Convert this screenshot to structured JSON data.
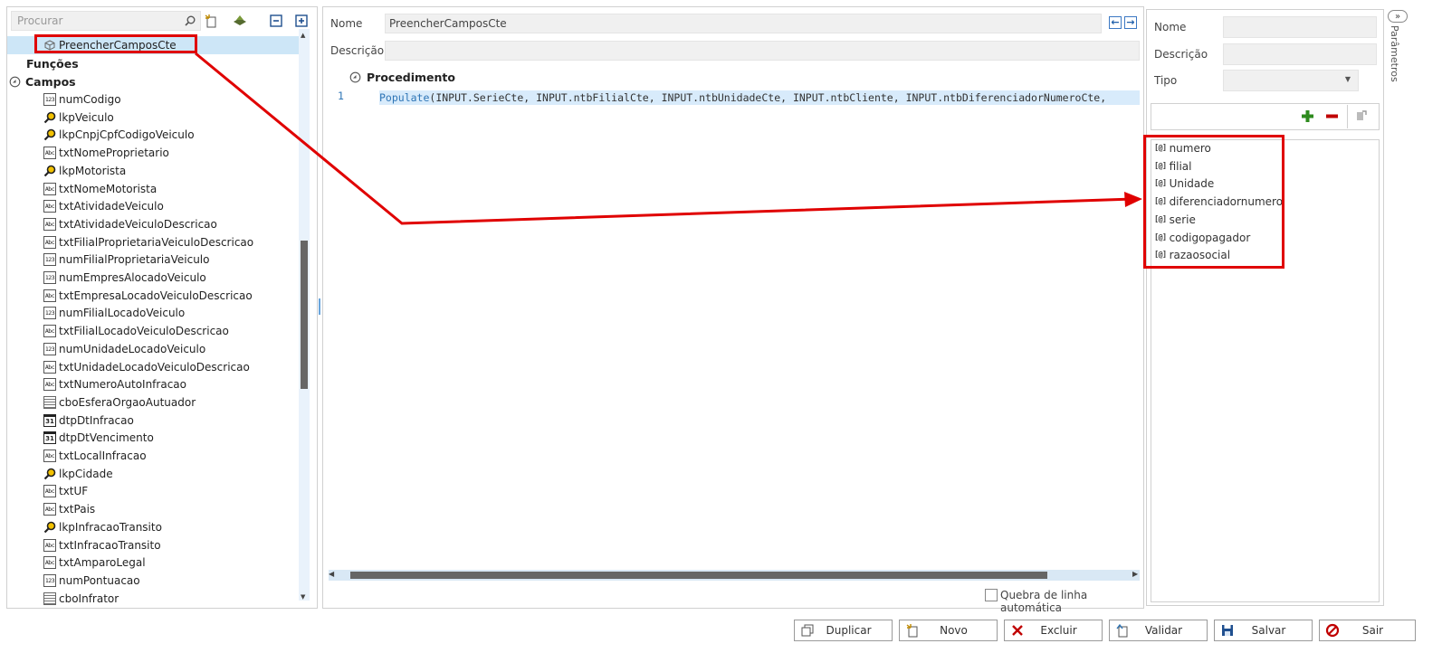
{
  "search": {
    "placeholder": "Procurar"
  },
  "tree": {
    "selected_item": "PreencherCamposCte",
    "section_funcoes": "Funções",
    "section_campos": "Campos",
    "fields": [
      {
        "type": "num",
        "label": "numCodigo"
      },
      {
        "type": "lkp",
        "label": "lkpVeiculo"
      },
      {
        "type": "lkp",
        "label": "lkpCnpjCpfCodigoVeiculo"
      },
      {
        "type": "txt",
        "label": "txtNomeProprietario"
      },
      {
        "type": "lkp",
        "label": "lkpMotorista"
      },
      {
        "type": "txt",
        "label": "txtNomeMotorista"
      },
      {
        "type": "txt",
        "label": "txtAtividadeVeiculo"
      },
      {
        "type": "txt",
        "label": "txtAtividadeVeiculoDescricao"
      },
      {
        "type": "txt",
        "label": "txtFilialProprietariaVeiculoDescricao"
      },
      {
        "type": "num",
        "label": "numFilialProprietariaVeiculo"
      },
      {
        "type": "num",
        "label": "numEmpresAlocadoVeiculo"
      },
      {
        "type": "txt",
        "label": "txtEmpresaLocadoVeiculoDescricao"
      },
      {
        "type": "num",
        "label": "numFilialLocadoVeiculo"
      },
      {
        "type": "txt",
        "label": "txtFilialLocadoVeiculoDescricao"
      },
      {
        "type": "num",
        "label": "numUnidadeLocadoVeiculo"
      },
      {
        "type": "txt",
        "label": "txtUnidadeLocadoVeiculoDescricao"
      },
      {
        "type": "txt",
        "label": "txtNumeroAutoInfracao"
      },
      {
        "type": "cbo",
        "label": "cboEsferaOrgaoAutuador"
      },
      {
        "type": "dtp",
        "label": "dtpDtInfracao"
      },
      {
        "type": "dtp",
        "label": "dtpDtVencimento"
      },
      {
        "type": "txt",
        "label": "txtLocalInfracao"
      },
      {
        "type": "lkp",
        "label": "lkpCidade"
      },
      {
        "type": "txt",
        "label": "txtUF"
      },
      {
        "type": "txt",
        "label": "txtPais"
      },
      {
        "type": "lkp",
        "label": "lkpInfracaoTransito"
      },
      {
        "type": "txt",
        "label": "txtInfracaoTransito"
      },
      {
        "type": "txt",
        "label": "txtAmparoLegal"
      },
      {
        "type": "num",
        "label": "numPontuacao"
      },
      {
        "type": "cbo",
        "label": "cboInfrator"
      }
    ]
  },
  "icon_glyphs": {
    "num": "123",
    "txt": "Abc",
    "dtp": "31"
  },
  "editor": {
    "name_label": "Nome",
    "name_value": "PreencherCamposCte",
    "description_label": "Descrição",
    "description_value": "",
    "procedure_header": "Procedimento",
    "line_number": "1",
    "code_fn": "Populate",
    "code_args": "(INPUT.SerieCte, INPUT.ntbFilialCte, INPUT.ntbUnidadeCte, INPUT.ntbCliente, INPUT.ntbDiferenciadorNumeroCte,",
    "word_wrap_label": "Quebra de linha automática"
  },
  "params": {
    "name_label": "Nome",
    "description_label": "Descrição",
    "type_label": "Tipo",
    "items": [
      "numero",
      "filial",
      "Unidade",
      "diferenciadornumero",
      "serie",
      "codigopagador",
      "razaosocial"
    ],
    "icon_glyph": "[@]",
    "tab_label": "Parâmetros"
  },
  "buttons": {
    "duplicate": "Duplicar",
    "new": "Novo",
    "delete": "Excluir",
    "validate": "Validar",
    "save": "Salvar",
    "exit": "Sair"
  },
  "colors": {
    "annotation_red": "#e00000",
    "selection_blue": "#cde6f7",
    "code_highlight": "#d8ebfb",
    "function_color": "#2e75b6",
    "add_green": "#2e8b1e",
    "remove_red": "#c00000"
  }
}
